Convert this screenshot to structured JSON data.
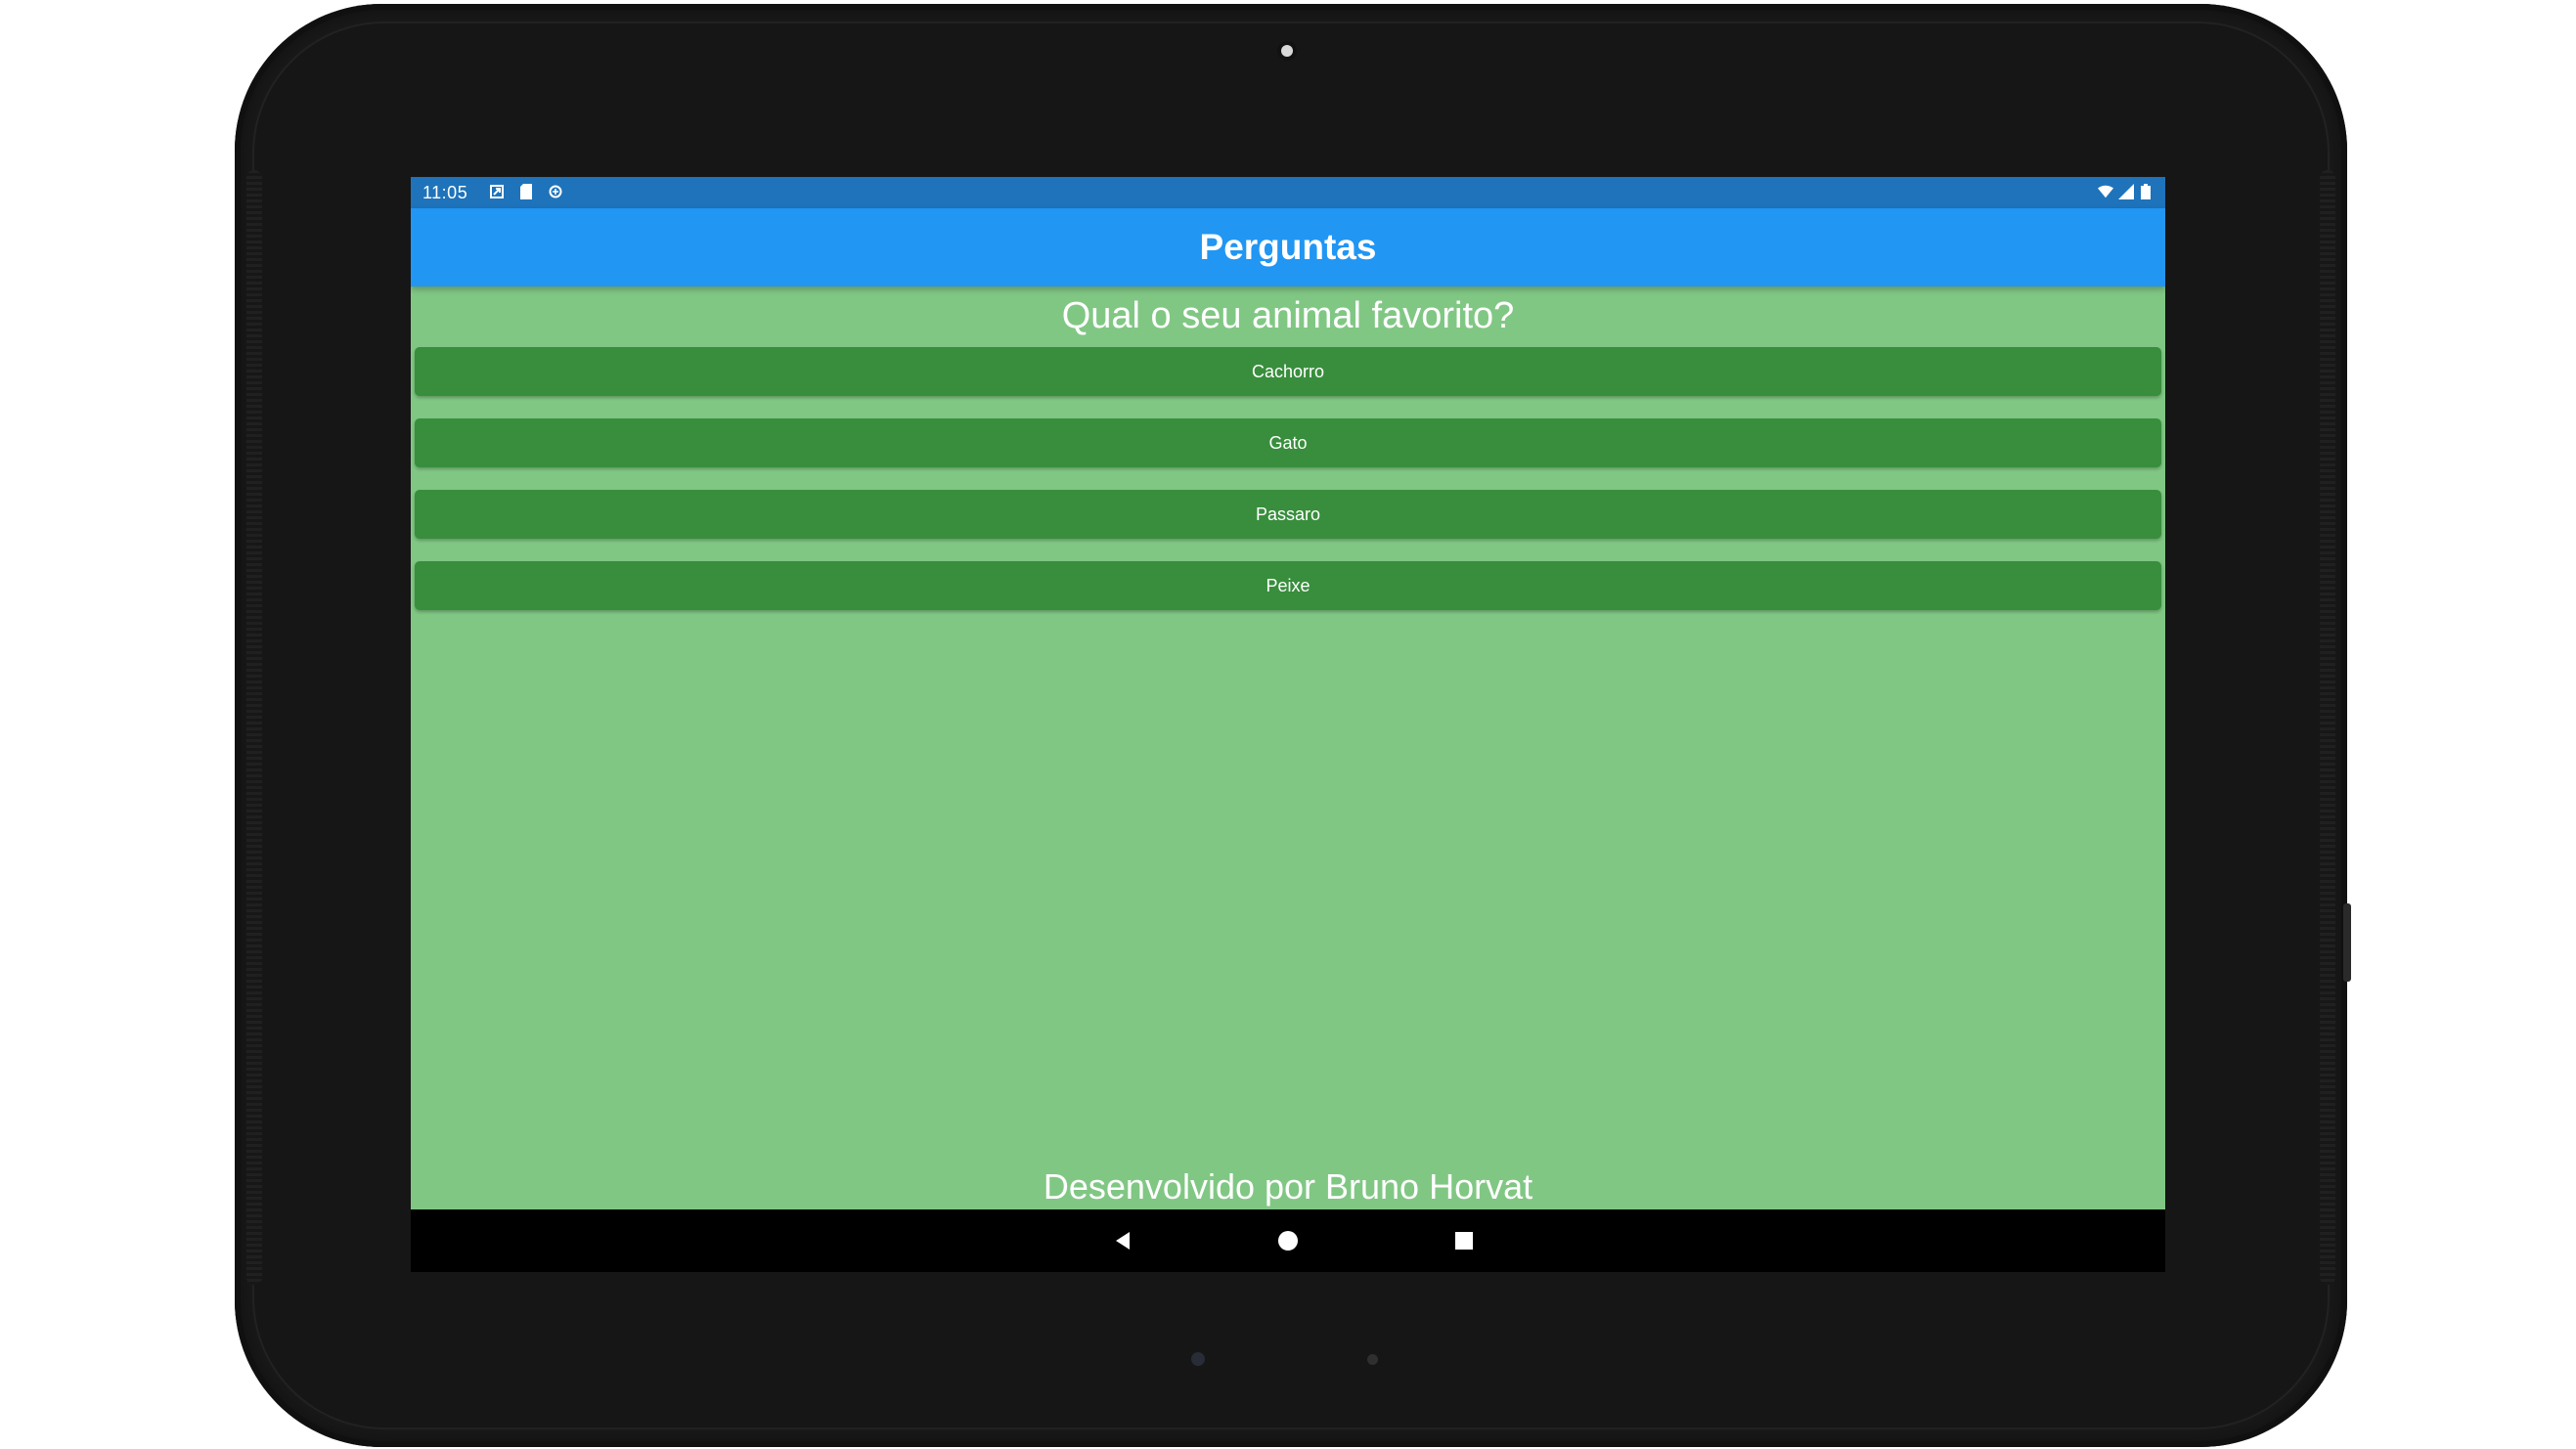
{
  "status_bar": {
    "time": "11:05",
    "left_icons": [
      "notification-icon",
      "sd-card-icon",
      "data-saver-icon"
    ],
    "right_icons": [
      "wifi-icon",
      "cell-signal-icon",
      "battery-icon"
    ]
  },
  "app_bar": {
    "title": "Perguntas",
    "color": "#2196f3",
    "status_color": "#1e73bb"
  },
  "content": {
    "background_color": "#81c784",
    "question": "Qual o seu animal favorito?",
    "answers": [
      {
        "label": "Cachorro"
      },
      {
        "label": "Gato"
      },
      {
        "label": "Passaro"
      },
      {
        "label": "Peixe"
      }
    ],
    "button_color": "#388e3c",
    "footer": "Desenvolvido por Bruno Horvat"
  },
  "nav_bar": {
    "buttons": [
      "back-icon",
      "home-icon",
      "recents-icon"
    ]
  }
}
